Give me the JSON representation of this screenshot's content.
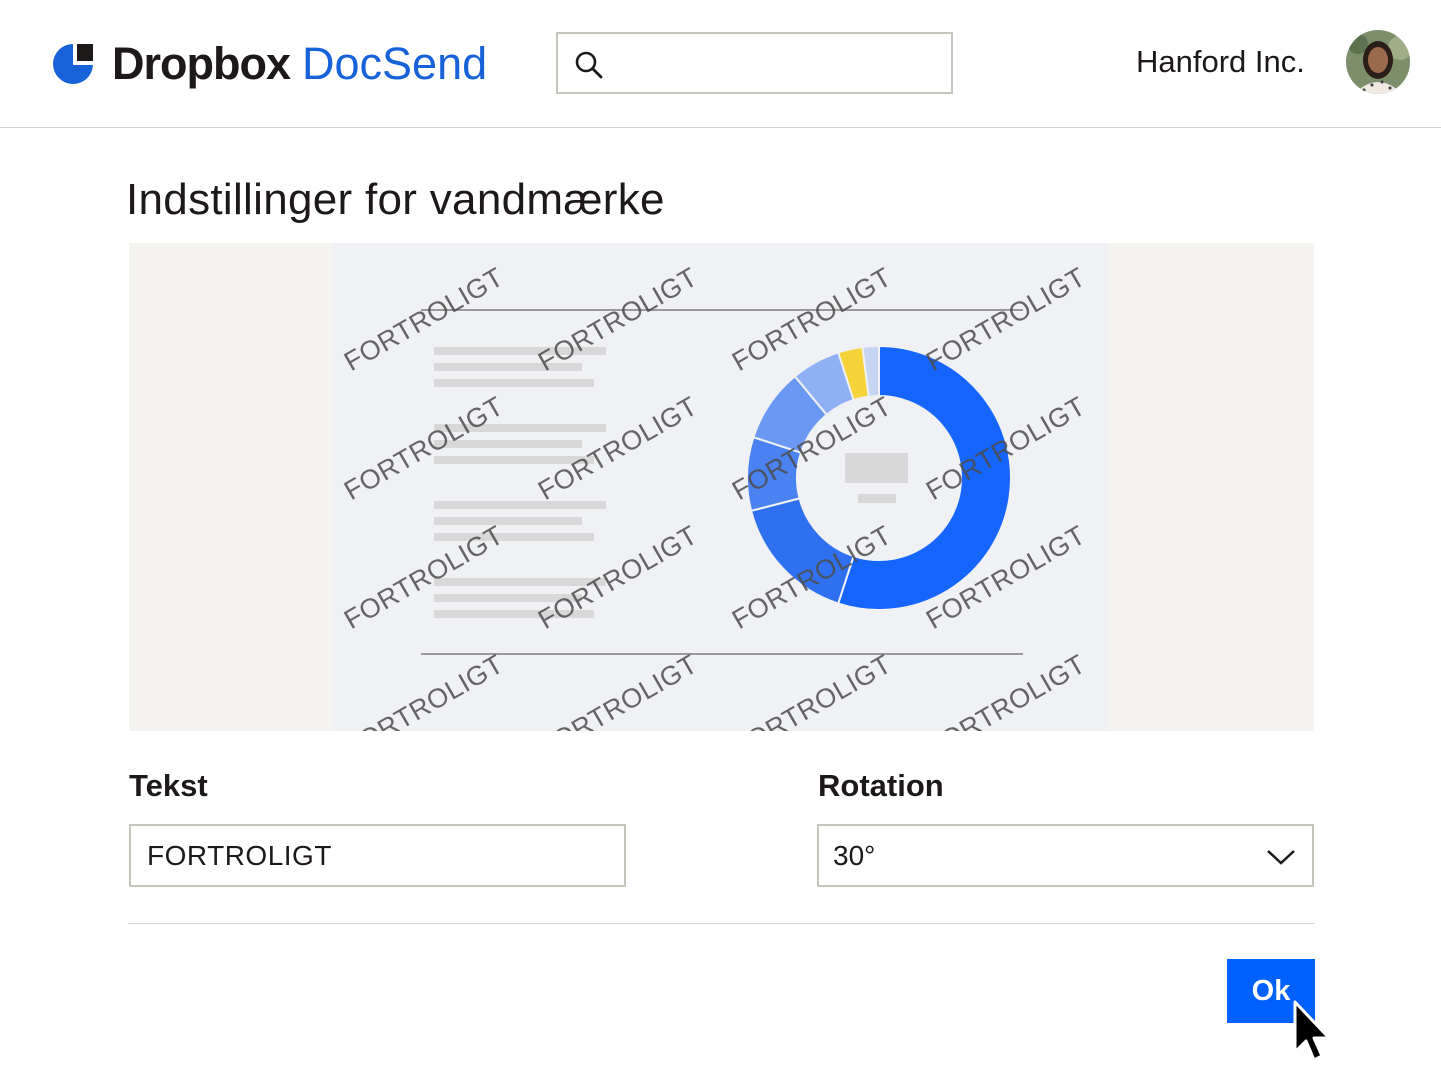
{
  "header": {
    "brand_primary": "Dropbox",
    "brand_secondary": "DocSend",
    "search": {
      "value": "",
      "placeholder": ""
    },
    "company": "Hanford Inc."
  },
  "page": {
    "title": "Indstillinger for vandmærke"
  },
  "preview": {
    "watermark_text": "FORTROLIGT",
    "watermark_rotation_deg": 30,
    "chart_data": {
      "type": "pie",
      "donut": true,
      "values": [
        55,
        16,
        9,
        9,
        6,
        3,
        2
      ],
      "colors": [
        "#1565fe",
        "#2f70f0",
        "#4a82f1",
        "#6b98f3",
        "#8fb0f5",
        "#f7d33a",
        "#c6d5f1"
      ],
      "legend": false,
      "title": ""
    }
  },
  "form": {
    "text_label": "Tekst",
    "text_value": "FORTROLIGT",
    "rotation_label": "Rotation",
    "rotation_value": "30°"
  },
  "actions": {
    "ok_label": "Ok"
  },
  "colors": {
    "brand_blue": "#1762d8",
    "button_blue": "#0061fe"
  }
}
